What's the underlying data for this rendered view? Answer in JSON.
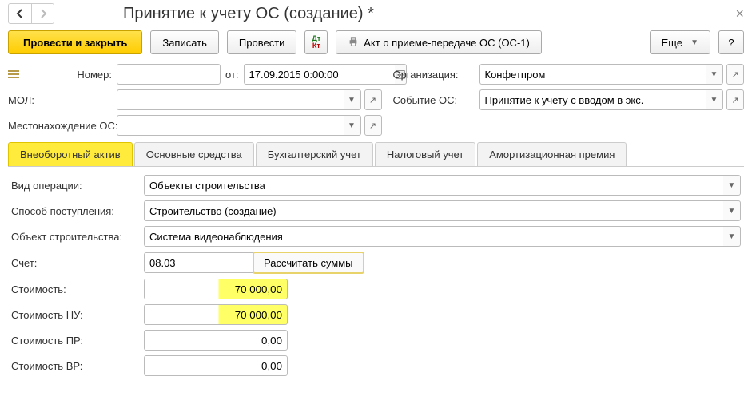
{
  "nav": {
    "title": "Принятие к учету ОС (создание) *"
  },
  "toolbar": {
    "post_close": "Провести и закрыть",
    "save": "Записать",
    "post": "Провести",
    "act": "Акт о приеме-передаче ОС (ОС-1)",
    "more": "Еще",
    "help": "?"
  },
  "header": {
    "number_label": "Номер:",
    "from_label": "от:",
    "date": "17.09.2015 0:00:00",
    "org_label": "Организация:",
    "org": "Конфетпром",
    "mol_label": "МОЛ:",
    "mol": "",
    "event_label": "Событие ОС:",
    "event": "Принятие к учету с вводом в экс.",
    "location_label": "Местонахождение ОС:",
    "location": ""
  },
  "tabs": [
    "Внеоборотный актив",
    "Основные средства",
    "Бухгалтерский учет",
    "Налоговый учет",
    "Амортизационная премия"
  ],
  "tab_active_index": 0,
  "form": {
    "op_type_label": "Вид операции:",
    "op_type": "Объекты строительства",
    "receipt_mode_label": "Способ поступления:",
    "receipt_mode": "Строительство (создание)",
    "object_label": "Объект строительства:",
    "object": "Система видеонаблюдения",
    "account_label": "Счет:",
    "account": "08.03",
    "calc_btn": "Рассчитать суммы",
    "cost_label": "Стоимость:",
    "cost": "70 000,00",
    "cost_nu_label": "Стоимость НУ:",
    "cost_nu": "70 000,00",
    "cost_pr_label": "Стоимость ПР:",
    "cost_pr": "0,00",
    "cost_vr_label": "Стоимость ВР:",
    "cost_vr": "0,00"
  }
}
